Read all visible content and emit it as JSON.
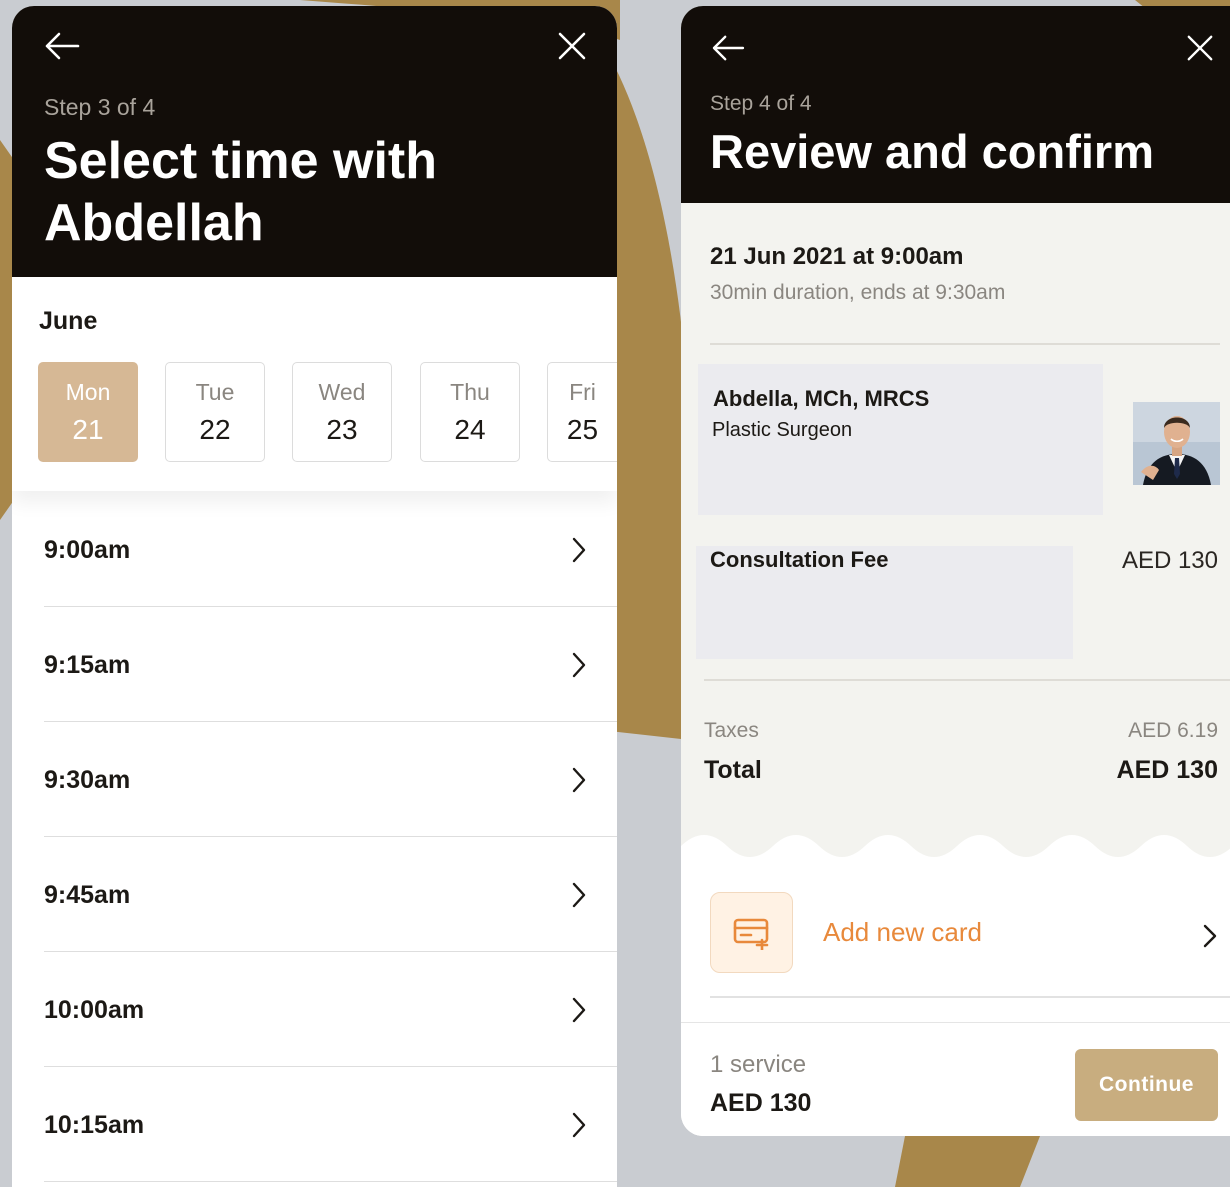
{
  "colors": {
    "header_bg": "#120d09",
    "accent_gold": "#c8ad7f",
    "selected_day": "#d6b895",
    "card_orange": "#e8893b",
    "background_ribbon": "#a8874a"
  },
  "time_screen": {
    "back_icon": "arrow-left-icon",
    "close_icon": "close-icon",
    "step": "Step 3 of 4",
    "title": "Select time with Abdellah",
    "month": "June",
    "days": [
      {
        "name": "Mon",
        "date": "21",
        "selected": true
      },
      {
        "name": "Tue",
        "date": "22",
        "selected": false
      },
      {
        "name": "Wed",
        "date": "23",
        "selected": false
      },
      {
        "name": "Thu",
        "date": "24",
        "selected": false
      },
      {
        "name": "Fri",
        "date": "25",
        "selected": false
      }
    ],
    "slots": [
      "9:00am",
      "9:15am",
      "9:30am",
      "9:45am",
      "10:00am",
      "10:15am"
    ]
  },
  "review_screen": {
    "back_icon": "arrow-left-icon",
    "close_icon": "close-icon",
    "step": "Step 4 of 4",
    "title": "Review and confirm",
    "appointment": {
      "datetime": "21 Jun 2021 at 9:00am",
      "duration": "30min duration, ends at 9:30am"
    },
    "doctor": {
      "name": "Abdella, MCh, MRCS",
      "specialty": "Plastic Surgeon"
    },
    "fee": {
      "label": "Consultation Fee",
      "amount": "AED 130"
    },
    "taxes": {
      "label": "Taxes",
      "amount": "AED 6.19"
    },
    "total": {
      "label": "Total",
      "amount": "AED 130"
    },
    "payment": {
      "label": "Add new card",
      "icon": "add-card-icon"
    },
    "footer": {
      "count": "1 service",
      "price": "AED 130",
      "button": "Continue"
    }
  }
}
